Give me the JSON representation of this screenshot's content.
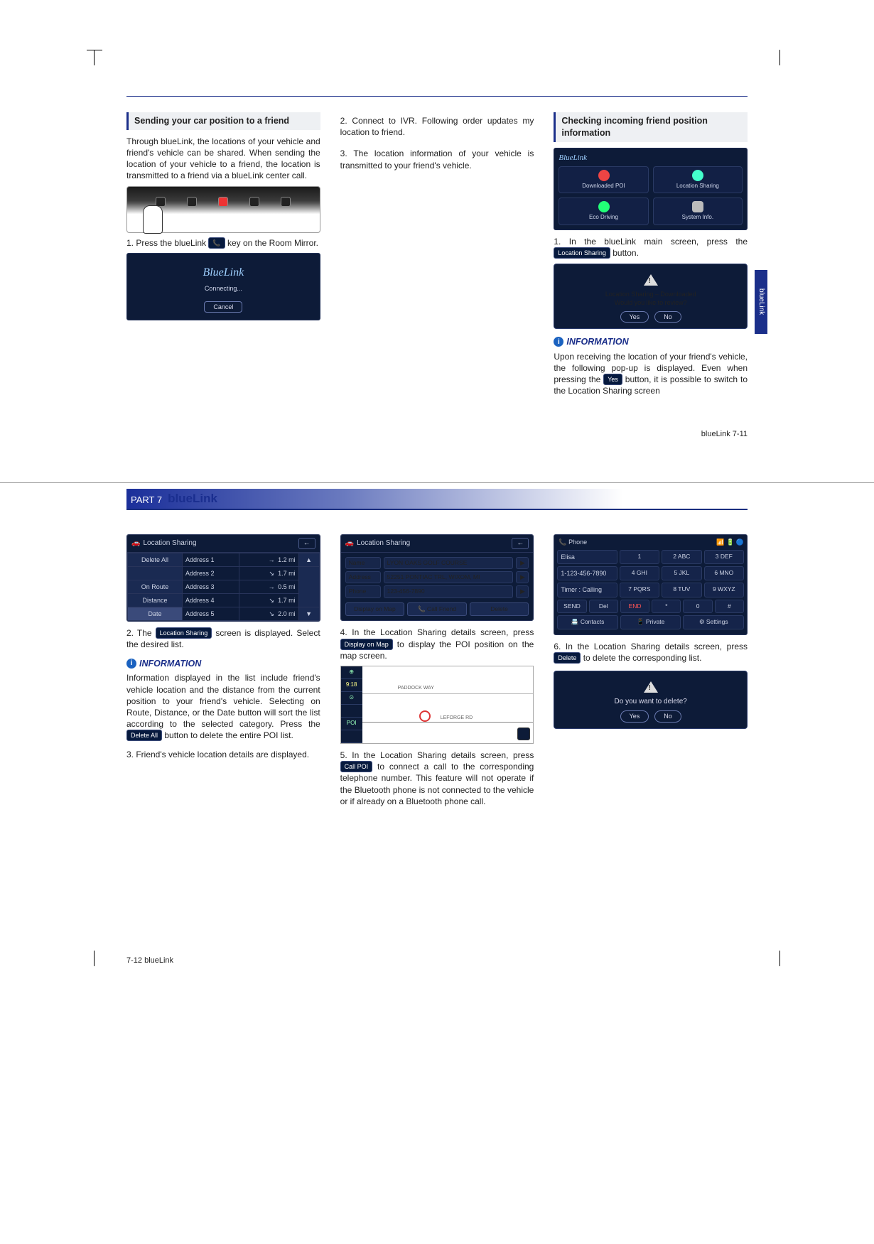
{
  "side_tab": "blueLink",
  "page1": {
    "footer": "blueLink   7-11",
    "col1": {
      "section": "Sending your car position to a friend",
      "intro": "Through blueLink, the locations of your vehicle and friend's vehicle can be shared. When sending the location of your vehicle to a friend, the location is transmitted to a friend via a blueLink center call.",
      "step1a": "1. Press the blueLink ",
      "step1b": " key on the Room Mirror.",
      "connecting_logo": "BlueLink",
      "connecting_text": "Connecting...",
      "connecting_cancel": "Cancel"
    },
    "col2": {
      "step2": "2. Connect to IVR. Following order updates my location to friend.",
      "step3": "3. The location information of your vehicle is transmitted to your friend's vehicle."
    },
    "col3": {
      "section": "Checking incoming friend position information",
      "tiles": {
        "t1": "Downloaded POI",
        "t2": "Location Sharing",
        "t3": "Eco Driving",
        "t4": "System Info."
      },
      "step1a": "1. In the blueLink main screen, press the ",
      "chip1": "Location Sharing",
      "step1b": " button.",
      "popup_line1": "Location Sharing – Downloaded",
      "popup_line2": "Would you like to review?",
      "popup_yes": "Yes",
      "popup_no": "No",
      "info_title": "INFORMATION",
      "info_a": "Upon receiving the location of your friend's vehicle, the following pop-up is displayed. Even when pressing the ",
      "info_chip": "Yes",
      "info_b": " button, it is possible to switch to the Location Sharing screen"
    }
  },
  "page2": {
    "part_label": "PART 7",
    "part_title": "blueLink",
    "footer": "7-12   blueLink",
    "col1": {
      "ls_title": "Location Sharing",
      "side_btns": [
        "Delete All",
        "On Route",
        "Distance",
        "Date"
      ],
      "rows": [
        {
          "name": "Address 1",
          "icon": "→",
          "dist": "1.2 mi"
        },
        {
          "name": "Address 2",
          "icon": "↘",
          "dist": "1.7 mi"
        },
        {
          "name": "Address 3",
          "icon": "→",
          "dist": "0.5 mi"
        },
        {
          "name": "Address 4",
          "icon": "↘",
          "dist": "1.7 mi"
        },
        {
          "name": "Address 5",
          "icon": "↘",
          "dist": "2.0 mi"
        }
      ],
      "step2a": "2. The ",
      "step2chip": "Location Sharing",
      "step2b": " screen is displayed. Select the desired list.",
      "info_title": "INFORMATION",
      "info_a": "Information displayed in the list include friend's vehicle location and the distance from the current position to your friend's vehicle. Selecting on Route, Distance, or the Date button will sort the list according to the selected category. Press the ",
      "info_chip": "Delete All",
      "info_b": " button to delete the entire POI list.",
      "step3": "3. Friend's vehicle location details are displayed."
    },
    "col2": {
      "ls_title": "Location Sharing",
      "detail": {
        "name_lbl": "Name",
        "name": "LYON OAKS GOLF COURSE",
        "addr_lbl": "Address",
        "addr": "52251 PONTIAC TRL, WIXOM, MI",
        "phone_lbl": "Phone",
        "phone": "123-456-7890"
      },
      "btns": {
        "map": "Display on Map",
        "call": "📞 Call Friend",
        "del": "Delete"
      },
      "step4a": "4. In the Location Sharing details screen, press ",
      "step4chip": "Display on Map",
      "step4b": " to display the POI position on the map screen.",
      "map_side": [
        "⊕",
        "9:18",
        "⊙",
        "",
        "POI",
        ""
      ],
      "map_lbl1": "PADDOCK WAY",
      "map_lbl2": "LEFORGE RD",
      "step5a": "5. In the Location Sharing details screen, press ",
      "step5chip": "Call POI",
      "step5b": " to connect a call to the corresponding telephone number. This feature will not operate if the Bluetooth phone is not connected to the vehicle or if already on a Bluetooth phone call."
    },
    "col3": {
      "phone_title": "Phone",
      "phone_name": "Elisa",
      "phone_num": "1-123-456-7890",
      "phone_status": "Timer : Calling",
      "keys_row1": [
        "1",
        "2 ABC",
        "3 DEF"
      ],
      "keys_row2": [
        "4 GHI",
        "5 JKL",
        "6 MNO"
      ],
      "keys_row3": [
        "7 PQRS",
        "8 TUV",
        "9 WXYZ"
      ],
      "ctrl_row": [
        "SEND",
        "Del",
        "END",
        "*",
        "0",
        "#"
      ],
      "bottom_row": [
        "📇 Contacts",
        "📱 Private",
        "⚙ Settings"
      ],
      "step6a": "6. In the Location Sharing details screen, press ",
      "step6chip": "Delete",
      "step6b": " to delete the corresponding list.",
      "popup_text": "Do you want to delete?",
      "popup_yes": "Yes",
      "popup_no": "No"
    }
  }
}
